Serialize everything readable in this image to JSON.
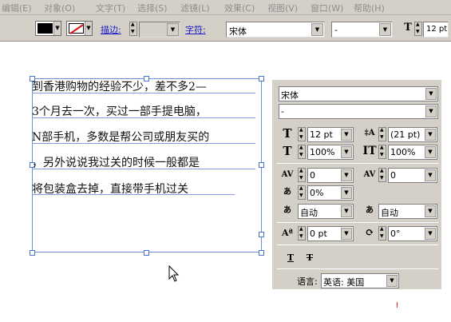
{
  "menu": {
    "items": [
      "编辑(E)",
      "对象(O)",
      "文字(T)",
      "选择(S)",
      "滤镜(L)",
      "效果(C)",
      "视图(V)",
      "窗口(W)",
      "帮助(H)"
    ]
  },
  "control_bar": {
    "stroke_label": "描边:",
    "char_label": "字符:",
    "font_family": "宋体",
    "font_style": "-",
    "font_size": "12 pt",
    "fill_color": "#000000",
    "stroke_color": "none"
  },
  "document": {
    "lines": [
      "到香港购物的经验不少，差不多2—",
      "3个月去一次，买过一部手提电脑，",
      "N部手机，多数是帮公司或朋友买的",
      "，另外说说我过关的时候一般都是",
      "将包装盒去掉，直接带手机过关"
    ]
  },
  "char_panel": {
    "font_family": "宋体",
    "font_style": "-",
    "font_size": "12 pt",
    "leading": "(21 pt)",
    "vertical_scale": "100%",
    "horizontal_scale": "100%",
    "kerning": "0",
    "tracking": "0",
    "tsume": "0%",
    "aki_left": "自动",
    "aki_right": "自动",
    "baseline_shift": "0 pt",
    "rotation": "0°",
    "language_label": "语言:",
    "language_value": "英语: 美国"
  },
  "colors": {
    "chrome": "#d4d0c8",
    "link": "#1a1ac8",
    "frame": "#6b8fd6"
  }
}
